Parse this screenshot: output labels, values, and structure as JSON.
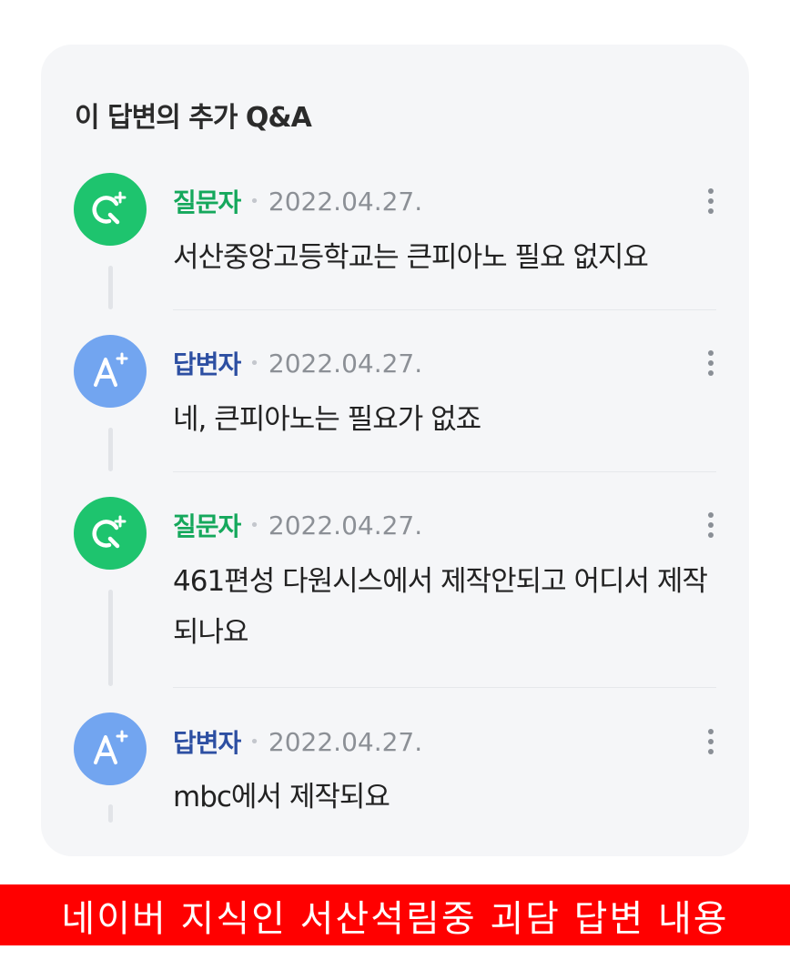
{
  "card": {
    "title": "이 답변의 추가 Q&A"
  },
  "items": [
    {
      "role": "질문자",
      "type": "question",
      "avatar_icon": "question-plus-icon",
      "date": "2022.04.27.",
      "text": "서산중앙고등학교는 큰피아노 필요 없지요"
    },
    {
      "role": "답변자",
      "type": "answer",
      "avatar_icon": "answer-plus-icon",
      "date": "2022.04.27.",
      "text": "네, 큰피아노는 필요가 없죠"
    },
    {
      "role": "질문자",
      "type": "question",
      "avatar_icon": "question-plus-icon",
      "date": "2022.04.27.",
      "text": "461편성 다원시스에서 제작안되고 어디서 제작되나요"
    },
    {
      "role": "답변자",
      "type": "answer",
      "avatar_icon": "answer-plus-icon",
      "date": "2022.04.27.",
      "text": "mbc에서 제작되요"
    }
  ],
  "colors": {
    "question_green": "#1ec46e",
    "answer_blue": "#72a5f0",
    "caption_red": "#ff0000"
  },
  "caption": "네이버 지식인 서산석림중 괴담 답변 내용"
}
